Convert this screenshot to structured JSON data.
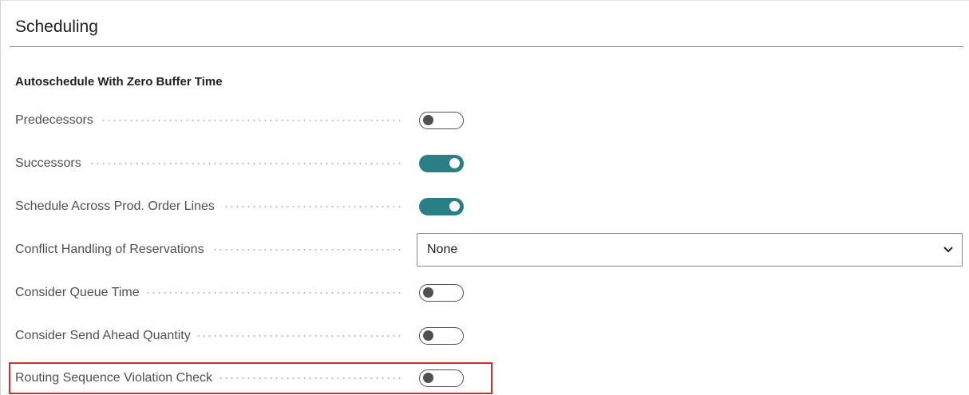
{
  "section": {
    "title": "Scheduling"
  },
  "group": {
    "title": "Autoschedule With Zero Buffer Time"
  },
  "fields": {
    "predecessors": {
      "label": "Predecessors",
      "value": false
    },
    "successors": {
      "label": "Successors",
      "value": true
    },
    "schedule_across_lines": {
      "label": "Schedule Across Prod. Order Lines",
      "value": true
    },
    "conflict_handling": {
      "label": "Conflict Handling of Reservations",
      "value": "None"
    },
    "consider_queue_time": {
      "label": "Consider Queue Time",
      "value": false
    },
    "consider_send_ahead": {
      "label": "Consider Send Ahead Quantity",
      "value": false
    },
    "routing_sequence_check": {
      "label": "Routing Sequence Violation Check",
      "value": false,
      "highlighted": true
    }
  },
  "colors": {
    "toggle_on": "#2a7f85",
    "highlight": "#e0281f"
  },
  "icons": {
    "dropdown": "chevron-down-icon"
  }
}
